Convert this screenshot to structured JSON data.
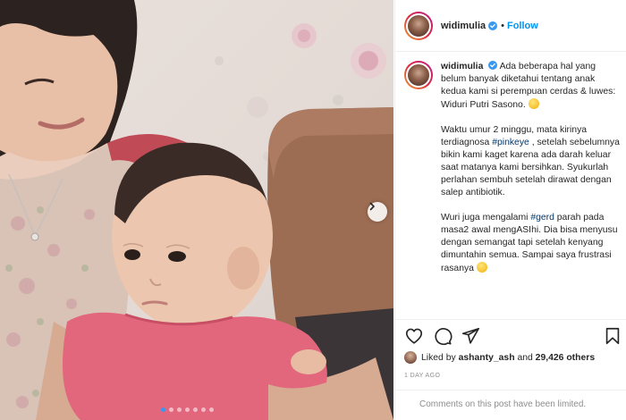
{
  "post": {
    "username": "widimulia",
    "separator": "•",
    "follow_label": "Follow",
    "next_arrow": "chevron-right-icon",
    "carousel": {
      "count": 7,
      "active_index": 0
    }
  },
  "caption": {
    "username": "widimulia",
    "p1": "Ada beberapa hal yang belum banyak diketahui tentang anak kedua kami si perempuan cerdas & luwes:",
    "p1b": "Widuri Putri Sasono.",
    "p2a": "Waktu umur 2 minggu, mata kirinya terdiagnosa",
    "p2tag": "#pinkeye",
    "p2b": ", setelah sebelumnya bikin kami kaget karena ada darah keluar saat matanya kami bersihkan. Syukurlah perlahan sembuh setelah dirawat dengan salep antibiotik.",
    "p3a": "Wuri juga mengalami",
    "p3tag": "#gerd",
    "p3b": "parah pada masa2 awal mengASIhi. Dia bisa menyusu dengan semangat tapi setelah kenyang dimuntahin semua. Sampai saya frustrasi rasanya"
  },
  "likes": {
    "prefix": "Liked by",
    "user": "ashanty_ash",
    "and": "and",
    "others": "29,426 others"
  },
  "timestamp": "1 DAY AGO",
  "comments_limited": "Comments on this post have been limited.",
  "icons": [
    "heart-icon",
    "comment-icon",
    "share-icon",
    "bookmark-icon",
    "verified-badge-icon"
  ],
  "colors": {
    "accent": "#0095f6",
    "hashtag": "#00376b",
    "muted": "#8e8e8e",
    "text": "#262626"
  }
}
